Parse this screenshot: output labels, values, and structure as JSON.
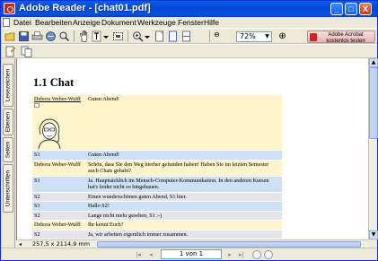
{
  "window": {
    "title": "Adobe Reader - [chat01.pdf]",
    "controls": {
      "minimize": "_",
      "maximize": "□",
      "close": "X"
    }
  },
  "menubar": {
    "items": [
      "Datei",
      "Bearbeiten",
      "Anzeige",
      "Dokument",
      "Werkzeuge",
      "Fenster",
      "Hilfe"
    ]
  },
  "toolbar": {
    "zoom_value": "72%",
    "zoom_out": "⊖",
    "zoom_in": "⊕",
    "acrobat_button_line1": "Adobe Acrobat",
    "acrobat_button_line2": "kostenlos testen"
  },
  "sidenav": {
    "tabs": [
      "Lesezeichen",
      "Ebenen",
      "Seiten",
      "Unterschriften"
    ]
  },
  "document": {
    "heading": "1.1 Chat",
    "messages": [
      {
        "speaker": "Debora Weber-Wulff",
        "text": "Guten Abend!",
        "kind": "dw",
        "has_picture": true
      },
      {
        "speaker": "S1",
        "text": "Guten Abend!",
        "kind": "s1"
      },
      {
        "speaker": "Debora Weber-Wulff",
        "text": "Schön, dass Sie den Weg hierher gefunden haben! Haben Sie im letzten Semester auch Chats gehabt?",
        "kind": "dw"
      },
      {
        "speaker": "S1",
        "text": "Ja. Hauptsächlich im Mensch-Computer-Kommunikation. In den anderen Kursen hat's leider nicht so hingehauen.",
        "kind": "s1"
      },
      {
        "speaker": "S2",
        "text": "Einen wunderschönen guten Abend, S1 hier.",
        "kind": "s2"
      },
      {
        "speaker": "S1",
        "text": "Hallo S2!",
        "kind": "s1"
      },
      {
        "speaker": "S2",
        "text": "Lange nicht mehr gesehen, S1 :-)",
        "kind": "s2"
      },
      {
        "speaker": "Debora Weber-Wulff",
        "text": "Ihr kennt Euch?",
        "kind": "dw"
      },
      {
        "speaker": "S2",
        "text": "Ja, wir arbeiten eigentlich immer zusammen.",
        "kind": "s2"
      }
    ]
  },
  "hscroll": {
    "page_size": "257,5 x 2114,9 mm"
  },
  "statusbar": {
    "page_counter": "1 von 1"
  }
}
